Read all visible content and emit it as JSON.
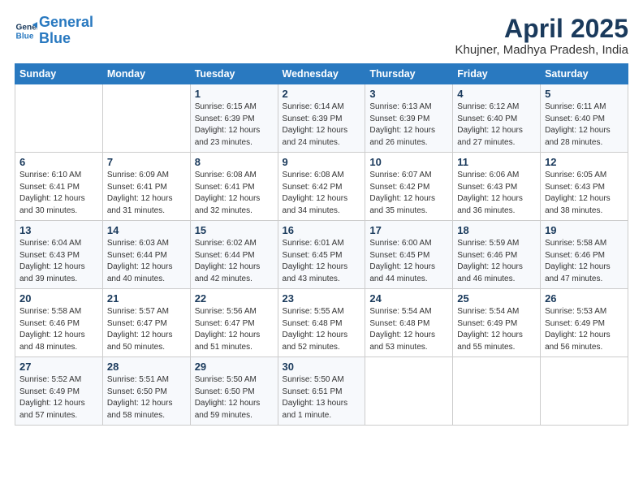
{
  "header": {
    "logo_line1": "General",
    "logo_line2": "Blue",
    "main_title": "April 2025",
    "subtitle": "Khujner, Madhya Pradesh, India"
  },
  "days_of_week": [
    "Sunday",
    "Monday",
    "Tuesday",
    "Wednesday",
    "Thursday",
    "Friday",
    "Saturday"
  ],
  "weeks": [
    [
      {
        "day": "",
        "info": ""
      },
      {
        "day": "",
        "info": ""
      },
      {
        "day": "1",
        "info": "Sunrise: 6:15 AM\nSunset: 6:39 PM\nDaylight: 12 hours and 23 minutes."
      },
      {
        "day": "2",
        "info": "Sunrise: 6:14 AM\nSunset: 6:39 PM\nDaylight: 12 hours and 24 minutes."
      },
      {
        "day": "3",
        "info": "Sunrise: 6:13 AM\nSunset: 6:39 PM\nDaylight: 12 hours and 26 minutes."
      },
      {
        "day": "4",
        "info": "Sunrise: 6:12 AM\nSunset: 6:40 PM\nDaylight: 12 hours and 27 minutes."
      },
      {
        "day": "5",
        "info": "Sunrise: 6:11 AM\nSunset: 6:40 PM\nDaylight: 12 hours and 28 minutes."
      }
    ],
    [
      {
        "day": "6",
        "info": "Sunrise: 6:10 AM\nSunset: 6:41 PM\nDaylight: 12 hours and 30 minutes."
      },
      {
        "day": "7",
        "info": "Sunrise: 6:09 AM\nSunset: 6:41 PM\nDaylight: 12 hours and 31 minutes."
      },
      {
        "day": "8",
        "info": "Sunrise: 6:08 AM\nSunset: 6:41 PM\nDaylight: 12 hours and 32 minutes."
      },
      {
        "day": "9",
        "info": "Sunrise: 6:08 AM\nSunset: 6:42 PM\nDaylight: 12 hours and 34 minutes."
      },
      {
        "day": "10",
        "info": "Sunrise: 6:07 AM\nSunset: 6:42 PM\nDaylight: 12 hours and 35 minutes."
      },
      {
        "day": "11",
        "info": "Sunrise: 6:06 AM\nSunset: 6:43 PM\nDaylight: 12 hours and 36 minutes."
      },
      {
        "day": "12",
        "info": "Sunrise: 6:05 AM\nSunset: 6:43 PM\nDaylight: 12 hours and 38 minutes."
      }
    ],
    [
      {
        "day": "13",
        "info": "Sunrise: 6:04 AM\nSunset: 6:43 PM\nDaylight: 12 hours and 39 minutes."
      },
      {
        "day": "14",
        "info": "Sunrise: 6:03 AM\nSunset: 6:44 PM\nDaylight: 12 hours and 40 minutes."
      },
      {
        "day": "15",
        "info": "Sunrise: 6:02 AM\nSunset: 6:44 PM\nDaylight: 12 hours and 42 minutes."
      },
      {
        "day": "16",
        "info": "Sunrise: 6:01 AM\nSunset: 6:45 PM\nDaylight: 12 hours and 43 minutes."
      },
      {
        "day": "17",
        "info": "Sunrise: 6:00 AM\nSunset: 6:45 PM\nDaylight: 12 hours and 44 minutes."
      },
      {
        "day": "18",
        "info": "Sunrise: 5:59 AM\nSunset: 6:46 PM\nDaylight: 12 hours and 46 minutes."
      },
      {
        "day": "19",
        "info": "Sunrise: 5:58 AM\nSunset: 6:46 PM\nDaylight: 12 hours and 47 minutes."
      }
    ],
    [
      {
        "day": "20",
        "info": "Sunrise: 5:58 AM\nSunset: 6:46 PM\nDaylight: 12 hours and 48 minutes."
      },
      {
        "day": "21",
        "info": "Sunrise: 5:57 AM\nSunset: 6:47 PM\nDaylight: 12 hours and 50 minutes."
      },
      {
        "day": "22",
        "info": "Sunrise: 5:56 AM\nSunset: 6:47 PM\nDaylight: 12 hours and 51 minutes."
      },
      {
        "day": "23",
        "info": "Sunrise: 5:55 AM\nSunset: 6:48 PM\nDaylight: 12 hours and 52 minutes."
      },
      {
        "day": "24",
        "info": "Sunrise: 5:54 AM\nSunset: 6:48 PM\nDaylight: 12 hours and 53 minutes."
      },
      {
        "day": "25",
        "info": "Sunrise: 5:54 AM\nSunset: 6:49 PM\nDaylight: 12 hours and 55 minutes."
      },
      {
        "day": "26",
        "info": "Sunrise: 5:53 AM\nSunset: 6:49 PM\nDaylight: 12 hours and 56 minutes."
      }
    ],
    [
      {
        "day": "27",
        "info": "Sunrise: 5:52 AM\nSunset: 6:49 PM\nDaylight: 12 hours and 57 minutes."
      },
      {
        "day": "28",
        "info": "Sunrise: 5:51 AM\nSunset: 6:50 PM\nDaylight: 12 hours and 58 minutes."
      },
      {
        "day": "29",
        "info": "Sunrise: 5:50 AM\nSunset: 6:50 PM\nDaylight: 12 hours and 59 minutes."
      },
      {
        "day": "30",
        "info": "Sunrise: 5:50 AM\nSunset: 6:51 PM\nDaylight: 13 hours and 1 minute."
      },
      {
        "day": "",
        "info": ""
      },
      {
        "day": "",
        "info": ""
      },
      {
        "day": "",
        "info": ""
      }
    ]
  ]
}
